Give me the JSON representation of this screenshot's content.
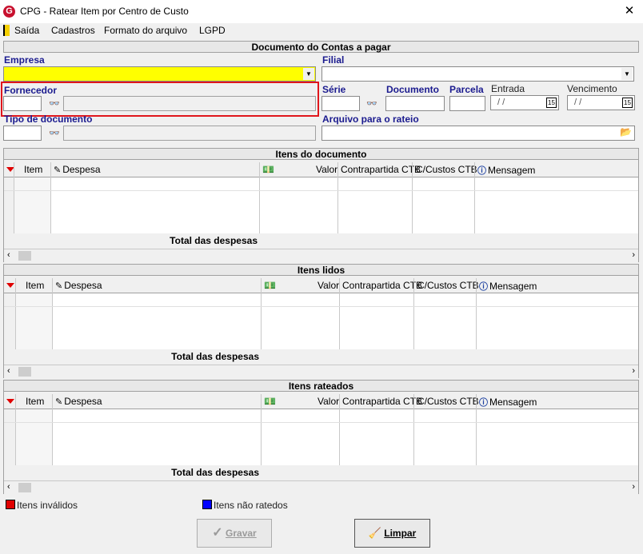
{
  "window": {
    "title": "CPG - Ratear Item por Centro de Custo",
    "close": "✕",
    "logo": "G"
  },
  "menu": [
    "Saída",
    "Cadastros",
    "Formato do arquivo",
    "LGPD"
  ],
  "doc_section": {
    "title": "Documento do Contas a pagar",
    "empresa_label": "Empresa",
    "filial_label": "Filial",
    "fornecedor_label": "Fornecedor",
    "serie_label": "Série",
    "documento_label": "Documento",
    "parcela_label": "Parcela",
    "entrada_label": "Entrada",
    "vencimento_label": "Vencimento",
    "entrada_value": " /  /",
    "vencimento_value": " /  /",
    "tipo_label": "Tipo de documento",
    "arquivo_label": "Arquivo para o rateio",
    "calendar_day": "15"
  },
  "grid_columns": {
    "item": "Item",
    "despesa": "Despesa",
    "valor": "Valor",
    "contrapartida": "Contrapartida CTB",
    "ccustos": "C/Custos CTB",
    "mensagem": "Mensagem"
  },
  "grids": [
    {
      "title": "Itens do documento",
      "total_label": "Total das despesas"
    },
    {
      "title": "Itens lidos",
      "total_label": "Total das despesas"
    },
    {
      "title": "Itens rateados",
      "total_label": "Total das despesas"
    }
  ],
  "legend": {
    "invalid_label": "Itens inválidos",
    "invalid_color": "#e00000",
    "not_rated_label": "Itens não ratedos",
    "not_rated_color": "#0000ff"
  },
  "buttons": {
    "gravar": "Gravar",
    "limpar": "Limpar"
  }
}
